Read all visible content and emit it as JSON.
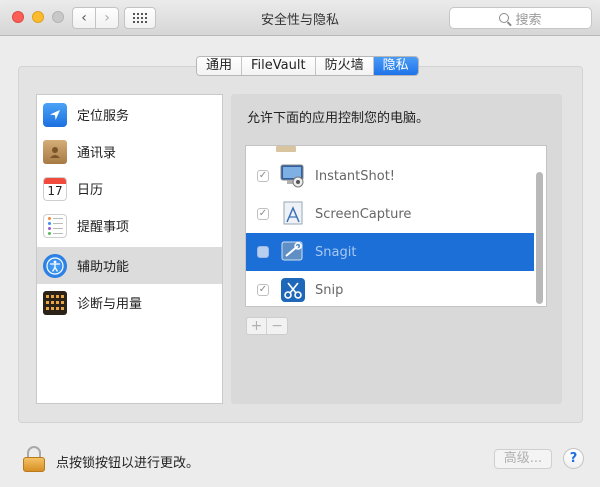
{
  "window": {
    "title": "安全性与隐私",
    "search_placeholder": "搜索"
  },
  "tabs": [
    {
      "label": "通用",
      "active": false
    },
    {
      "label": "FileVault",
      "active": false
    },
    {
      "label": "防火墙",
      "active": false
    },
    {
      "label": "隐私",
      "active": true
    }
  ],
  "sidebar": {
    "items": [
      {
        "label": "定位服务",
        "icon": "location-icon"
      },
      {
        "label": "通讯录",
        "icon": "contacts-icon"
      },
      {
        "label": "日历",
        "icon": "calendar-icon",
        "icon_text": "17"
      },
      {
        "label": "提醒事项",
        "icon": "reminders-icon"
      },
      {
        "label": "辅助功能",
        "icon": "accessibility-icon",
        "selected": true
      },
      {
        "label": "诊断与用量",
        "icon": "diagnostics-icon"
      }
    ]
  },
  "main": {
    "heading": "允许下面的应用控制您的电脑。",
    "apps": [
      {
        "name": "InstantShot!",
        "checked": true,
        "selected": false,
        "icon": "instantshot-icon"
      },
      {
        "name": "ScreenCapture",
        "checked": true,
        "selected": false,
        "icon": "screencapture-icon"
      },
      {
        "name": "Snagit",
        "checked": false,
        "selected": true,
        "icon": "snagit-icon"
      },
      {
        "name": "Snip",
        "checked": true,
        "selected": false,
        "icon": "snip-icon"
      }
    ],
    "add_label": "+",
    "remove_label": "−"
  },
  "footer": {
    "lock_text": "点按锁按钮以进行更改。",
    "advanced_label": "高级...",
    "help_label": "?"
  },
  "colors": {
    "accent": "#1c6fd6",
    "tab_active": "#2a7ff0"
  }
}
